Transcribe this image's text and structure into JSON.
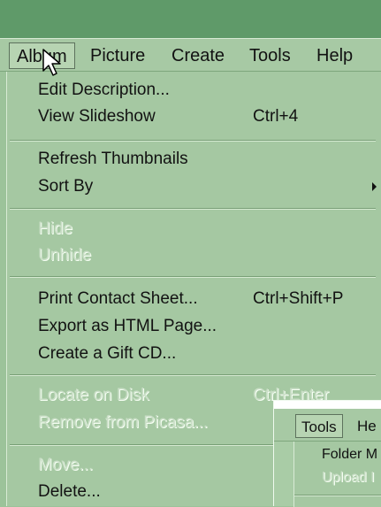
{
  "menubar": {
    "items": [
      "Album",
      "Picture",
      "Create",
      "Tools",
      "Help"
    ]
  },
  "album_menu": {
    "edit_description": "Edit Description...",
    "view_slideshow": "View Slideshow",
    "view_slideshow_shortcut": "Ctrl+4",
    "refresh_thumbnails": "Refresh Thumbnails",
    "sort_by": "Sort By",
    "hide": "Hide",
    "unhide": "Unhide",
    "print_contact_sheet": "Print Contact Sheet...",
    "print_contact_sheet_shortcut": "Ctrl+Shift+P",
    "export_as_html": "Export as HTML Page...",
    "create_gift_cd": "Create a Gift CD...",
    "locate_on_disk": "Locate on Disk",
    "locate_on_disk_shortcut": "Ctrl+Enter",
    "remove_from_picasa": "Remove from Picasa...",
    "move": "Move...",
    "delete": "Delete..."
  },
  "overlay": {
    "menubar": [
      "Tools",
      "He"
    ],
    "items": [
      "Folder M",
      "Upload I"
    ]
  },
  "colors": {
    "title_bar": "#5f9a69",
    "menu_background": "#a5c8a2",
    "text": "#121212",
    "disabled_text": "#c9dec6"
  },
  "icons": {
    "cursor": "mouse-pointer-icon",
    "submenu": "submenu-arrow-icon"
  }
}
